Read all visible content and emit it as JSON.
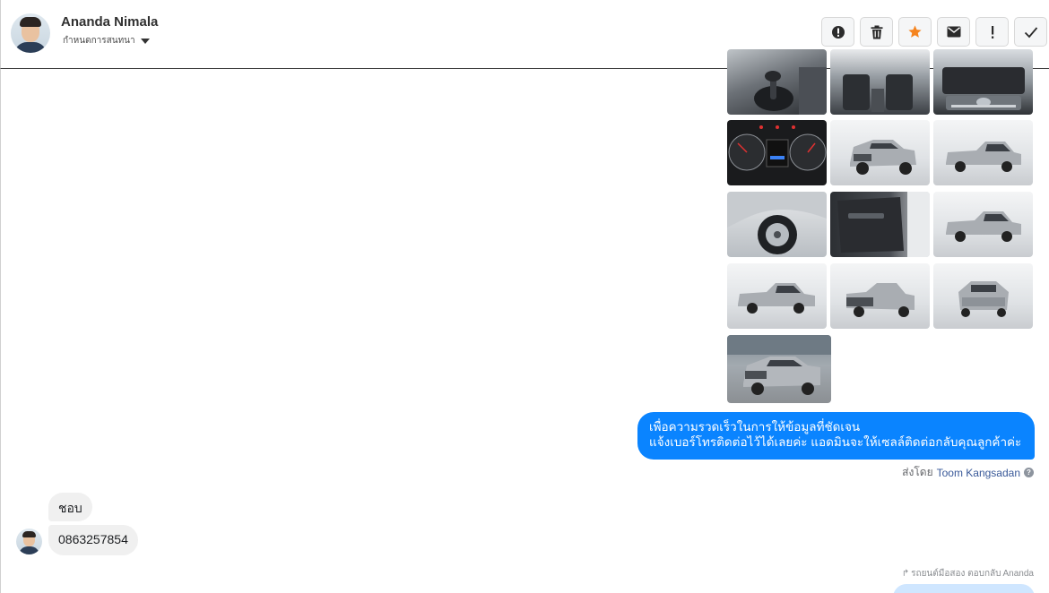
{
  "header": {
    "user_name": "Ananda Nimala",
    "user_subtitle": "กำหนดการสนทนา",
    "actions": [
      {
        "name": "spam-report",
        "icon": "alert-circle-icon"
      },
      {
        "name": "delete",
        "icon": "trash-icon"
      },
      {
        "name": "star",
        "icon": "star-icon",
        "color": "#f5841f"
      },
      {
        "name": "mark-unread",
        "icon": "envelope-icon"
      },
      {
        "name": "follow-up",
        "icon": "exclamation-icon"
      },
      {
        "name": "mark-done",
        "icon": "checkmark-icon"
      }
    ]
  },
  "thread": {
    "photos": [
      {
        "theme": "gear-shifter"
      },
      {
        "theme": "cabin-seats"
      },
      {
        "theme": "engine-bay"
      },
      {
        "theme": "dashboard-gauges"
      },
      {
        "theme": "truck-front-quarter"
      },
      {
        "theme": "truck-side"
      },
      {
        "theme": "wheel-closeup"
      },
      {
        "theme": "door-interior"
      },
      {
        "theme": "truck-side"
      },
      {
        "theme": "truck-side"
      },
      {
        "theme": "truck-rear-quarter"
      },
      {
        "theme": "truck-rear"
      },
      {
        "theme": "truck-outdoor"
      }
    ],
    "outgoing_message": {
      "line1": "เพื่อความรวดเร็วในการให้ข้อมูลที่ชัดเจน",
      "line2": "แจ้งเบอร์โทรติดต่อไว้ได้เลยค่ะ แอดมินจะให้เซลล์ติดต่อกลับคุณลูกค้าค่ะ",
      "sent_by_prefix": "ส่งโดย",
      "sent_by_name": "Toom Kangsadan",
      "help_glyph": "?"
    },
    "incoming_messages": [
      {
        "text": "ชอบ"
      },
      {
        "text": "0863257854"
      }
    ],
    "reply_note": {
      "label": "รถยนต์มือสอง ตอบกลับ",
      "name": "Ananda"
    },
    "colors": {
      "outgoing_bubble": "#0a84ff",
      "incoming_bubble": "#f0f0f0",
      "accent_star": "#f5841f"
    }
  }
}
